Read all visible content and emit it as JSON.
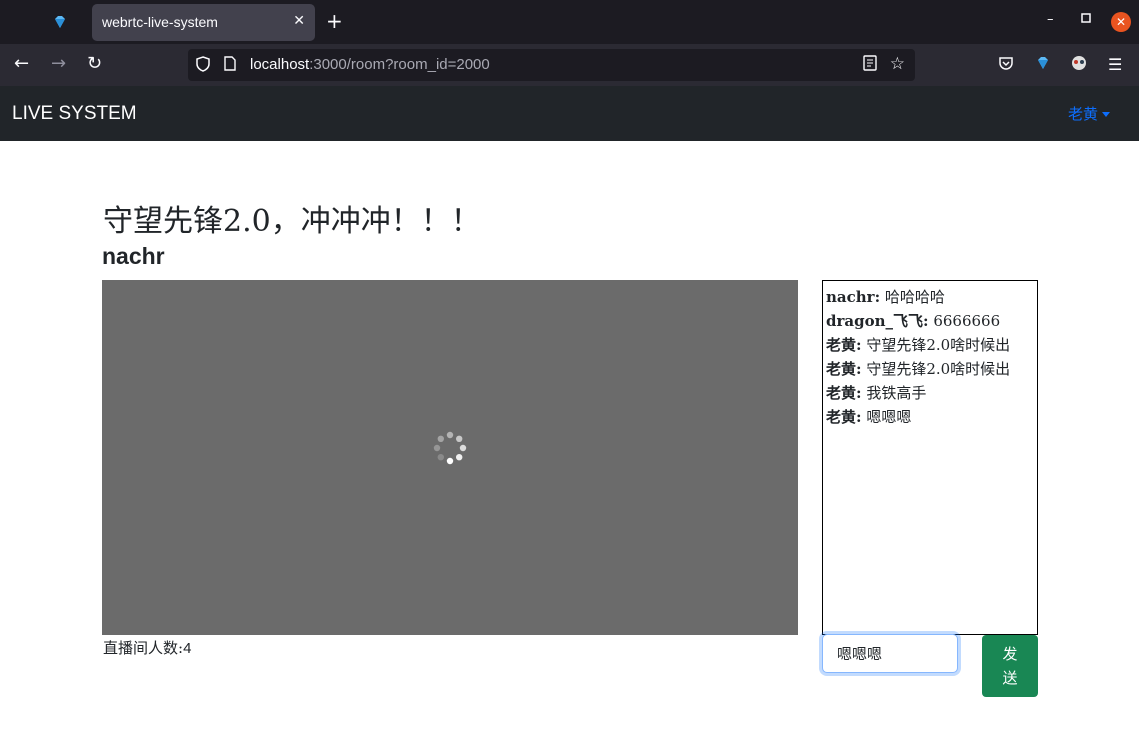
{
  "browser": {
    "tab_title": "webrtc-live-system",
    "tab_close": "✕",
    "new_tab": "+",
    "url_host": "localhost",
    "url_path": ":3000/room?room_id=2000"
  },
  "site": {
    "brand": "LIVE SYSTEM",
    "user_name": "老黄"
  },
  "room": {
    "title": "守望先锋2.0，冲冲冲！！！",
    "anchor_name": "nachr",
    "viewers_label": "直播间人数:",
    "viewers_count": "4"
  },
  "chat": {
    "messages": [
      {
        "user": "nachr:",
        "text": " 哈哈哈哈"
      },
      {
        "user": "dragon_飞飞:",
        "text": " 6666666"
      },
      {
        "user": "老黄:",
        "text": " 守望先锋2.0啥时候出"
      },
      {
        "user": "老黄:",
        "text": " 守望先锋2.0啥时候出"
      },
      {
        "user": "老黄:",
        "text": " 我铁高手"
      },
      {
        "user": "老黄:",
        "text": " 嗯嗯嗯"
      }
    ],
    "input_value": "嗯嗯嗯",
    "send_label": "发送"
  },
  "colors": {
    "site_nav_bg": "#212529",
    "video_bg": "#6b6b6b",
    "send_button": "#198754",
    "user_link": "#0d6efd"
  }
}
